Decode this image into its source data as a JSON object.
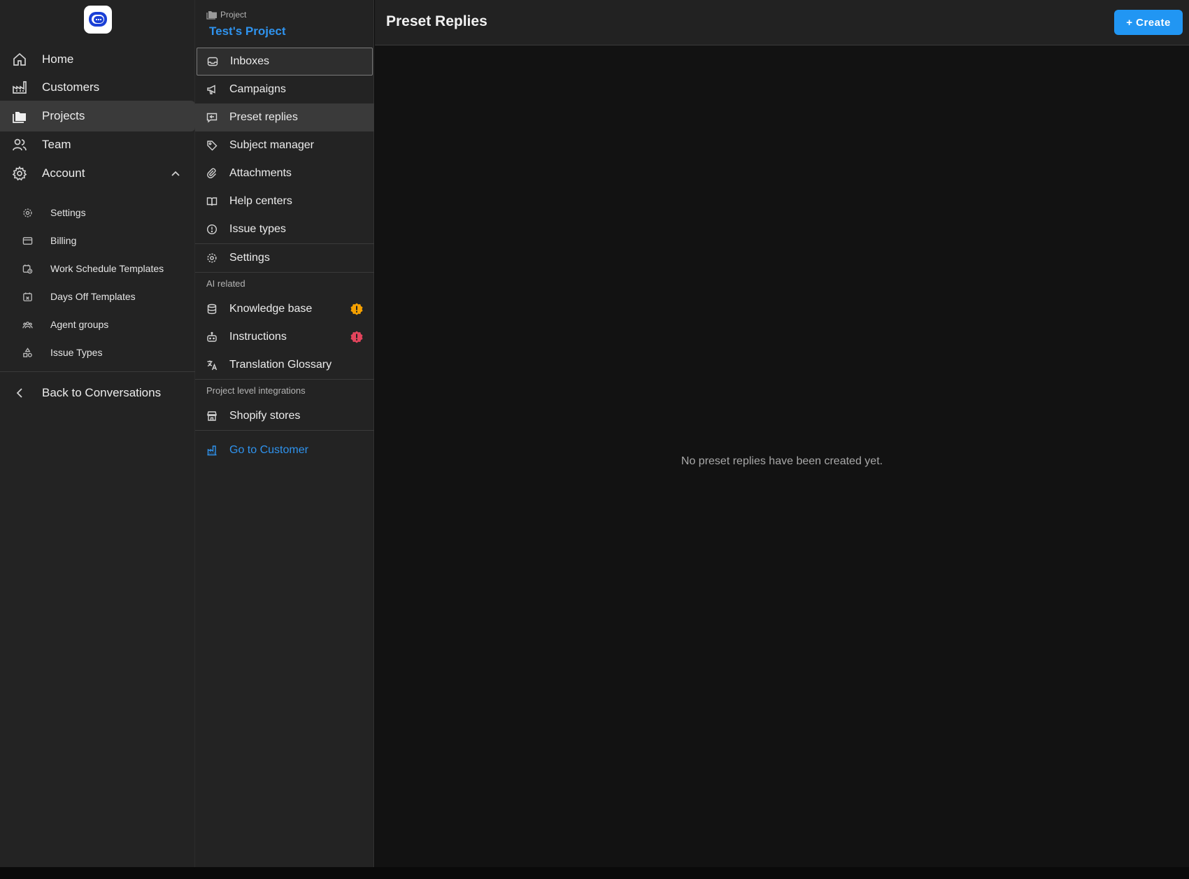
{
  "sidebar": {
    "items": [
      {
        "label": "Home"
      },
      {
        "label": "Customers"
      },
      {
        "label": "Projects"
      },
      {
        "label": "Team"
      },
      {
        "label": "Account"
      }
    ],
    "account_sub": [
      {
        "label": "Settings"
      },
      {
        "label": "Billing"
      },
      {
        "label": "Work Schedule Templates"
      },
      {
        "label": "Days Off Templates"
      },
      {
        "label": "Agent groups"
      },
      {
        "label": "Issue Types"
      }
    ],
    "back_label": "Back to Conversations"
  },
  "project": {
    "caption": "Project",
    "name": "Test's Project",
    "items": [
      {
        "label": "Inboxes"
      },
      {
        "label": "Campaigns"
      },
      {
        "label": "Preset replies"
      },
      {
        "label": "Subject manager"
      },
      {
        "label": "Attachments"
      },
      {
        "label": "Help centers"
      },
      {
        "label": "Issue types"
      },
      {
        "label": "Settings"
      }
    ],
    "ai_section": "AI related",
    "ai_items": [
      {
        "label": "Knowledge base",
        "badge_color": "#f5a000"
      },
      {
        "label": "Instructions",
        "badge_color": "#e2445c"
      },
      {
        "label": "Translation Glossary"
      }
    ],
    "integrations_section": "Project level integrations",
    "integration_items": [
      {
        "label": "Shopify stores"
      }
    ],
    "go_to_customer": "Go to Customer"
  },
  "main": {
    "title": "Preset Replies",
    "create_label": "+ Create",
    "empty_message": "No preset replies have been created yet."
  },
  "colors": {
    "accent": "#2196f3",
    "link": "#2f93ee"
  }
}
